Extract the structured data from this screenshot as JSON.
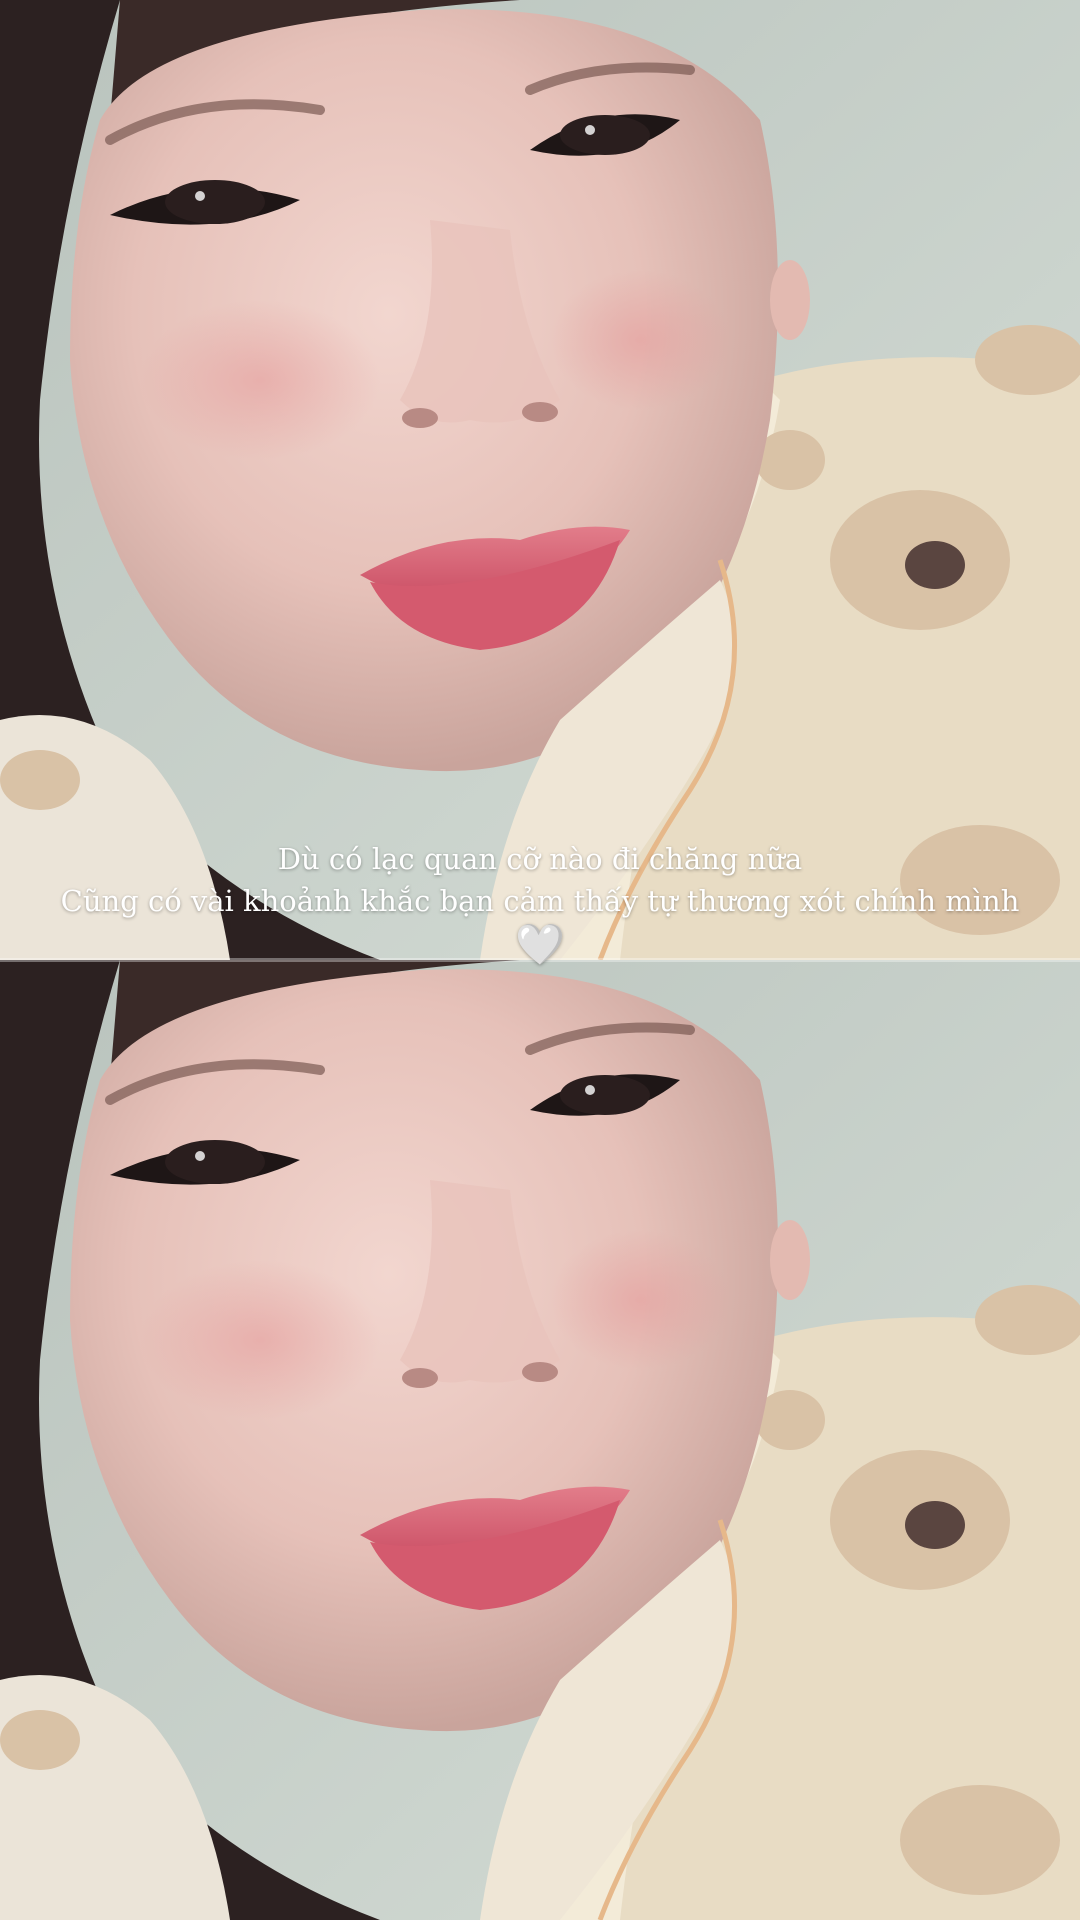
{
  "caption": {
    "line1": "Dù có lạc quan cỡ nào đi chăng nữa",
    "line2": "Cũng có vài khoảnh khắc bạn cảm thấy tự thương xót chính mình",
    "emoji": "🤍"
  },
  "photo": {
    "subject": "selfie-photo",
    "frames": 2
  },
  "colors": {
    "wall": "#c9d2cb",
    "skin": "#e8c6c0",
    "hair": "#2c2121",
    "lips": "#d45a6e",
    "blanket": "#e9dcc3",
    "caption_text": "#ffffff"
  }
}
